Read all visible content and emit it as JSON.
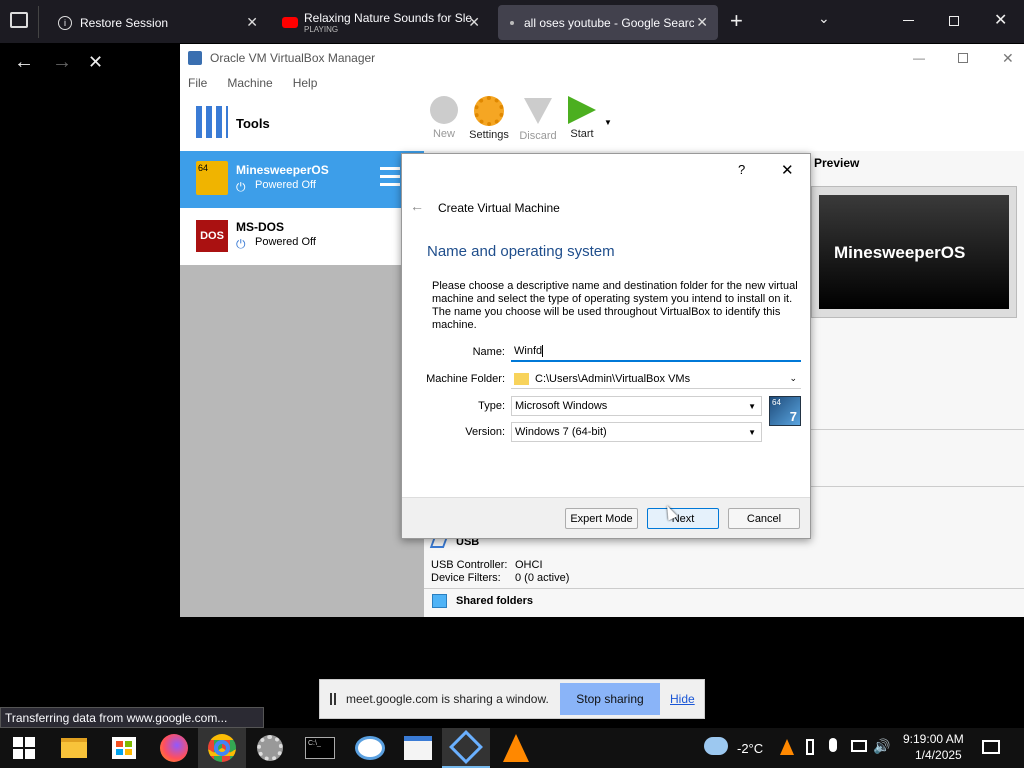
{
  "browser": {
    "tabs": [
      {
        "label": "Restore Session"
      },
      {
        "label": "Relaxing Nature Sounds for Sle",
        "sub": "PLAYING"
      },
      {
        "label": "all oses youtube - Google Searc"
      }
    ]
  },
  "vbox": {
    "title": "Oracle VM VirtualBox Manager",
    "menu": [
      "File",
      "Machine",
      "Help"
    ],
    "tools": "Tools",
    "vms": [
      {
        "name": "MinesweeperOS",
        "state": "Powered Off"
      },
      {
        "name": "MS-DOS",
        "state": "Powered Off"
      }
    ],
    "toolbar": [
      "New",
      "Settings",
      "Discard",
      "Start"
    ],
    "preview_title": "Preview",
    "preview_name": "MinesweeperOS",
    "usb": {
      "title": "USB",
      "controller_label": "USB Controller:",
      "controller": "OHCI",
      "filters_label": "Device Filters:",
      "filters": "0 (0 active)"
    },
    "shared": "Shared folders"
  },
  "dialog": {
    "help": "?",
    "header": "Create Virtual Machine",
    "title": "Name and operating system",
    "desc": "Please choose a descriptive name and destination folder for the new virtual machine and select the type of operating system you intend to install on it. The name you choose will be used throughout VirtualBox to identify this machine.",
    "name_label": "Name:",
    "name_value": "Winfd",
    "folder_label": "Machine Folder:",
    "folder_value": "C:\\Users\\Admin\\VirtualBox VMs",
    "type_label": "Type:",
    "type_value": "Microsoft Windows",
    "version_label": "Version:",
    "version_value": "Windows 7 (64-bit)",
    "expert": "Expert Mode",
    "next": "Next",
    "cancel": "Cancel"
  },
  "share": {
    "text": "meet.google.com is sharing a window.",
    "stop": "Stop sharing",
    "hide": "Hide"
  },
  "status": "Transferring data from www.google.com...",
  "clock": {
    "time": "9:19:00 AM",
    "date": "1/4/2025",
    "temp": "-2°C"
  }
}
